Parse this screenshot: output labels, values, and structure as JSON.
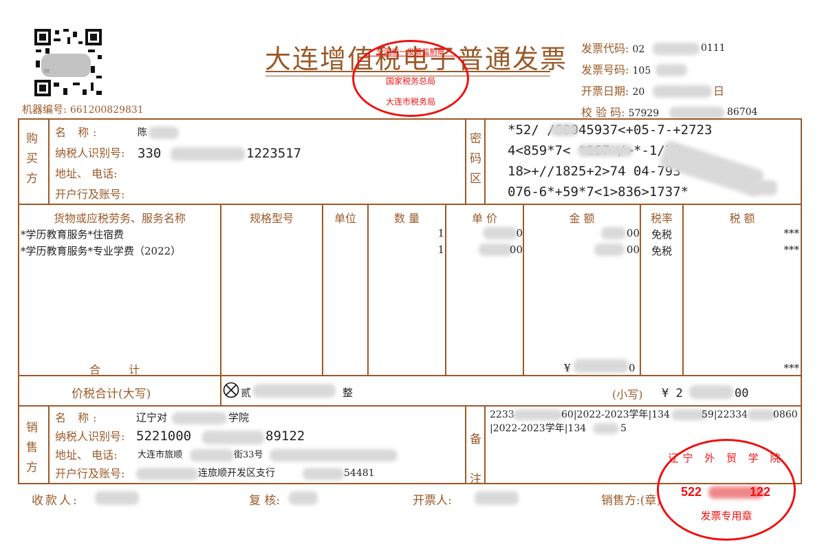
{
  "title": "大连增值税电子普通发票",
  "machine_no": {
    "label": "机器编号:",
    "value": "661200829831"
  },
  "header_info": {
    "code_label": "发票代码:",
    "code_value": "02",
    "code_tail": "0111",
    "no_label": "发票号码:",
    "no_value": "105",
    "date_label": "开票日期:",
    "date_value": "20",
    "date_tail": "日",
    "check_label": "校 验 码:",
    "check_value": "57929",
    "check_tail": "86704"
  },
  "buyer": {
    "section_label": [
      "购",
      "买",
      "方"
    ],
    "name_label": "名 称:",
    "name_value": "陈",
    "tax_id_label": "纳税人识别号:",
    "tax_id_head": "330",
    "tax_id_tail": "1223517",
    "address_label": "地址、 电话:",
    "bank_label": "开户行及账号:"
  },
  "cipher": {
    "section_label": [
      "密",
      "码",
      "区"
    ],
    "lines": [
      "*52/ /60045937<+05-7-+2723",
      "4<859*7< *167-/>*-1/79>",
      "18>+//1825+2>74 04-793",
      "076-6*+59*7<1>836>1737*"
    ]
  },
  "columns": {
    "item": "货物或应税劳务、服务名称",
    "spec": "规格型号",
    "unit": "单位",
    "qty": "数 量",
    "price": "单 价",
    "amount": "金 额",
    "rate": "税率",
    "tax": "税 额"
  },
  "items": [
    {
      "name": "*学历教育服务*住宿费",
      "qty": "1",
      "price_tail": "0",
      "amount_tail": "00",
      "rate": "免税",
      "tax": "***"
    },
    {
      "name": "*学历教育服务*专业学费（2022）",
      "qty": "1",
      "price_tail": "00",
      "amount_tail": "00",
      "rate": "免税",
      "tax": "***"
    }
  ],
  "subtotal": {
    "label": "合 计",
    "amount_prefix": "¥",
    "amount_tail": "0",
    "tax": "***"
  },
  "total": {
    "label": "价税合计(大写)",
    "words_head": "贰",
    "words_tail": "整",
    "small_label": "(小写)",
    "small_value": "¥ 2",
    "small_tail": "00"
  },
  "seller": {
    "section_label": [
      "销",
      "售",
      "方"
    ],
    "name_label": "名 称:",
    "name_head": "辽宁对",
    "name_tail": "学院",
    "tax_id_label": "纳税人识别号:",
    "tax_id_head": "5221000",
    "tax_id_tail": "89122",
    "address_label": "地址、 电话:",
    "address_head": "大连市旅顺",
    "address_tail": "街33号",
    "bank_label": "开户行及账号:",
    "bank_mid": "连旅顺开发区支行",
    "bank_tail": "54481"
  },
  "remarks": {
    "section_label": [
      "备",
      "注"
    ],
    "line1_parts": [
      "2233",
      "60|2022-2023学年|134",
      "59|22334",
      "0860"
    ],
    "line2_parts": [
      "|2022-2023学年|134",
      "5"
    ]
  },
  "footer": {
    "payee": "收款人:",
    "reviewer": "复 核:",
    "issuer": "开票人:",
    "seller_seal": "销售方:(章)"
  },
  "stamps": {
    "tax_bureau": {
      "top": "全国统一发票监制章",
      "middle": "国家税务总局",
      "bottom": "大连市税务局"
    },
    "seller": {
      "ring": "辽宁 外 贸 学 院",
      "number_head": "522",
      "number_tail": "122",
      "label": "发票专用章"
    }
  },
  "colors": {
    "frame": "#9a5a28",
    "stamp": "#e11111"
  }
}
